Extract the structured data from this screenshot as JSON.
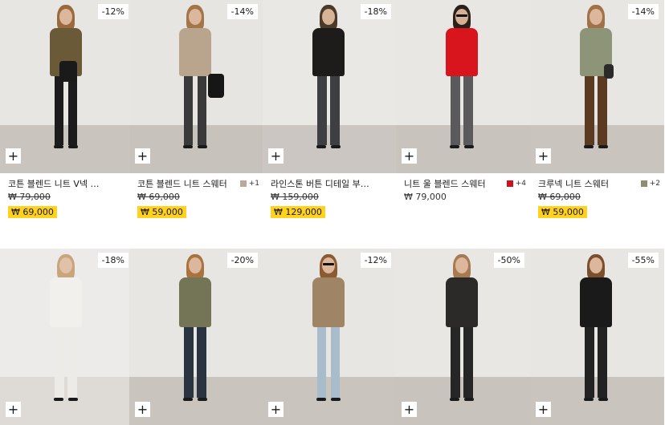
{
  "products": [
    {
      "discount": "-12%",
      "name": "코튼 블렌드 니트 V넥 스웨터",
      "orig": "₩ 79,000",
      "sale": "₩ 69,000",
      "swatch": null,
      "colors": {
        "wall": "#e8e6e3",
        "floor": "#c9c4be",
        "top": "#6b5a37",
        "legs": "#1c1c1c",
        "hair": "#9a6a3e",
        "skin": "#dcb79c",
        "bag": "#1a1a1a"
      }
    },
    {
      "discount": "-14%",
      "name": "코튼 블렌드 니트 스웨터",
      "orig": "₩ 69,000",
      "sale": "₩ 59,000",
      "swatch": {
        "color": "#b9aa9a",
        "count": "+1"
      },
      "colors": {
        "wall": "#e7e5e2",
        "floor": "#c7c2bc",
        "top": "#b9a58d",
        "legs": "#3a3a3b",
        "hair": "#a3764a",
        "skin": "#dcb79c",
        "bag": "#161616"
      }
    },
    {
      "discount": "-18%",
      "name": "라인스톤 버튼 디테일 부클레 카디건",
      "orig": "₩ 159,000",
      "sale": "₩ 129,000",
      "swatch": null,
      "colors": {
        "wall": "#eae8e5",
        "floor": "#cbc6c1",
        "top": "#1e1c1a",
        "legs": "#3e3f42",
        "hair": "#4a3a2c",
        "skin": "#d8b497",
        "bag": null
      }
    },
    {
      "discount": null,
      "name": "니트 울 블렌드 스웨터",
      "orig": "₩ 79,000",
      "sale": null,
      "swatch": {
        "color": "#d0101a",
        "count": "+4"
      },
      "colors": {
        "wall": "#e9e7e4",
        "floor": "#c8c3bd",
        "top": "#d8141c",
        "legs": "#5a5a5d",
        "hair": "#2a211a",
        "skin": "#d6b094",
        "bag": null
      }
    },
    {
      "discount": "-14%",
      "name": "크루넥 니트 스웨터",
      "orig": "₩ 69,000",
      "sale": "₩ 59,000",
      "swatch": {
        "color": "#8f8c73",
        "count": "+2"
      },
      "colors": {
        "wall": "#e8e6e3",
        "floor": "#c9c4be",
        "top": "#8e9477",
        "legs": "#5b3a22",
        "hair": "#a07248",
        "skin": "#dcb79c",
        "bag": "#2a2a2a"
      }
    },
    {
      "discount": "-18%",
      "name": "",
      "orig": "",
      "sale": null,
      "swatch": null,
      "colors": {
        "wall": "#ecebe9",
        "floor": "#dedbd7",
        "top": "#f2f0ec",
        "legs": "#ecebe7",
        "hair": "#c9a57c",
        "skin": "#e1c2a8",
        "bag": null
      }
    },
    {
      "discount": "-20%",
      "name": "",
      "orig": "",
      "sale": null,
      "swatch": null,
      "colors": {
        "wall": "#e8e6e3",
        "floor": "#c9c4be",
        "top": "#737556",
        "legs": "#2a3340",
        "hair": "#a8733f",
        "skin": "#dcb79c",
        "bag": null
      }
    },
    {
      "discount": "-12%",
      "name": "",
      "orig": "",
      "sale": null,
      "swatch": null,
      "colors": {
        "wall": "#e8e6e3",
        "floor": "#c9c4be",
        "top": "#a08466",
        "legs": "#a9bccb",
        "hair": "#8a5a32",
        "skin": "#dcb79c",
        "bag": null
      }
    },
    {
      "discount": "-50%",
      "name": "",
      "orig": "",
      "sale": null,
      "swatch": null,
      "colors": {
        "wall": "#e9e7e4",
        "floor": "#c8c3bd",
        "top": "#2c2a28",
        "legs": "#262626",
        "hair": "#a67b52",
        "skin": "#dcb79c",
        "bag": null
      }
    },
    {
      "discount": "-55%",
      "name": "",
      "orig": "",
      "sale": null,
      "swatch": null,
      "colors": {
        "wall": "#e8e6e3",
        "floor": "#c9c4be",
        "top": "#1a1a1a",
        "legs": "#222222",
        "hair": "#7a4e2e",
        "skin": "#dcb79c",
        "bag": null
      }
    }
  ],
  "icons": {
    "add": "+"
  }
}
